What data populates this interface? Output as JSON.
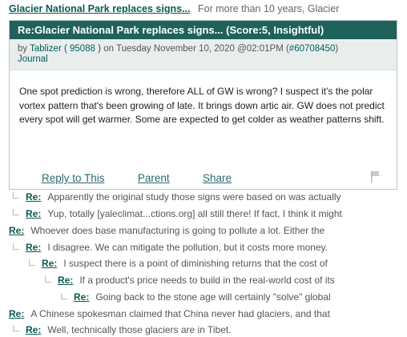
{
  "parent": {
    "title": "Glacier National Park replaces signs...",
    "snippet": "For more than 10 years, Glacier"
  },
  "comment": {
    "subject": "Re:Glacier National Park replaces signs... (Score:5, Insightful)",
    "meta_by": "by ",
    "author": "Tablizer",
    "author_id": "( 95088 )",
    "meta_on": " on Tuesday November 10, 2020 @02:01PM (",
    "comment_id": "#60708450",
    "meta_close": ")",
    "journal": "Journal",
    "body": "One spot prediction is wrong, therefore ALL of GW is wrong? I suspect it's the polar vortex pattern that's been growing of late. It brings down artic air. GW does not predict every spot will get warmer. Some are expected to get colder as weather patterns shift.",
    "actions": {
      "reply": "Reply to This",
      "parent": "Parent",
      "share": "Share"
    }
  },
  "replies": [
    {
      "re": "Re:",
      "text": "Apparently the original study those signs were based on was actually"
    },
    {
      "re": "Re:",
      "text": "Yup, totally [yaleclimat...ctions.org] all still there! If fact, I think it might"
    },
    {
      "re": "Re:",
      "text": "Whoever does base manufacturing is going to pollute a lot. Either the"
    },
    {
      "re": "Re:",
      "text": "I disagree. We can mitigate the pollution, but it costs more money."
    },
    {
      "re": "Re:",
      "text": "I suspect there is a point of diminishing returns that the cost of"
    },
    {
      "re": "Re:",
      "text": "If a product's price needs to build in the real-world cost of its"
    },
    {
      "re": "Re:",
      "text": "Going back to the stone age will certainly \"solve\" global"
    },
    {
      "re": "Re:",
      "text": "A Chinese spokesman claimed that China never had glaciers, and that"
    },
    {
      "re": "Re:",
      "text": "Well, technically those glaciers are in Tibet."
    }
  ]
}
